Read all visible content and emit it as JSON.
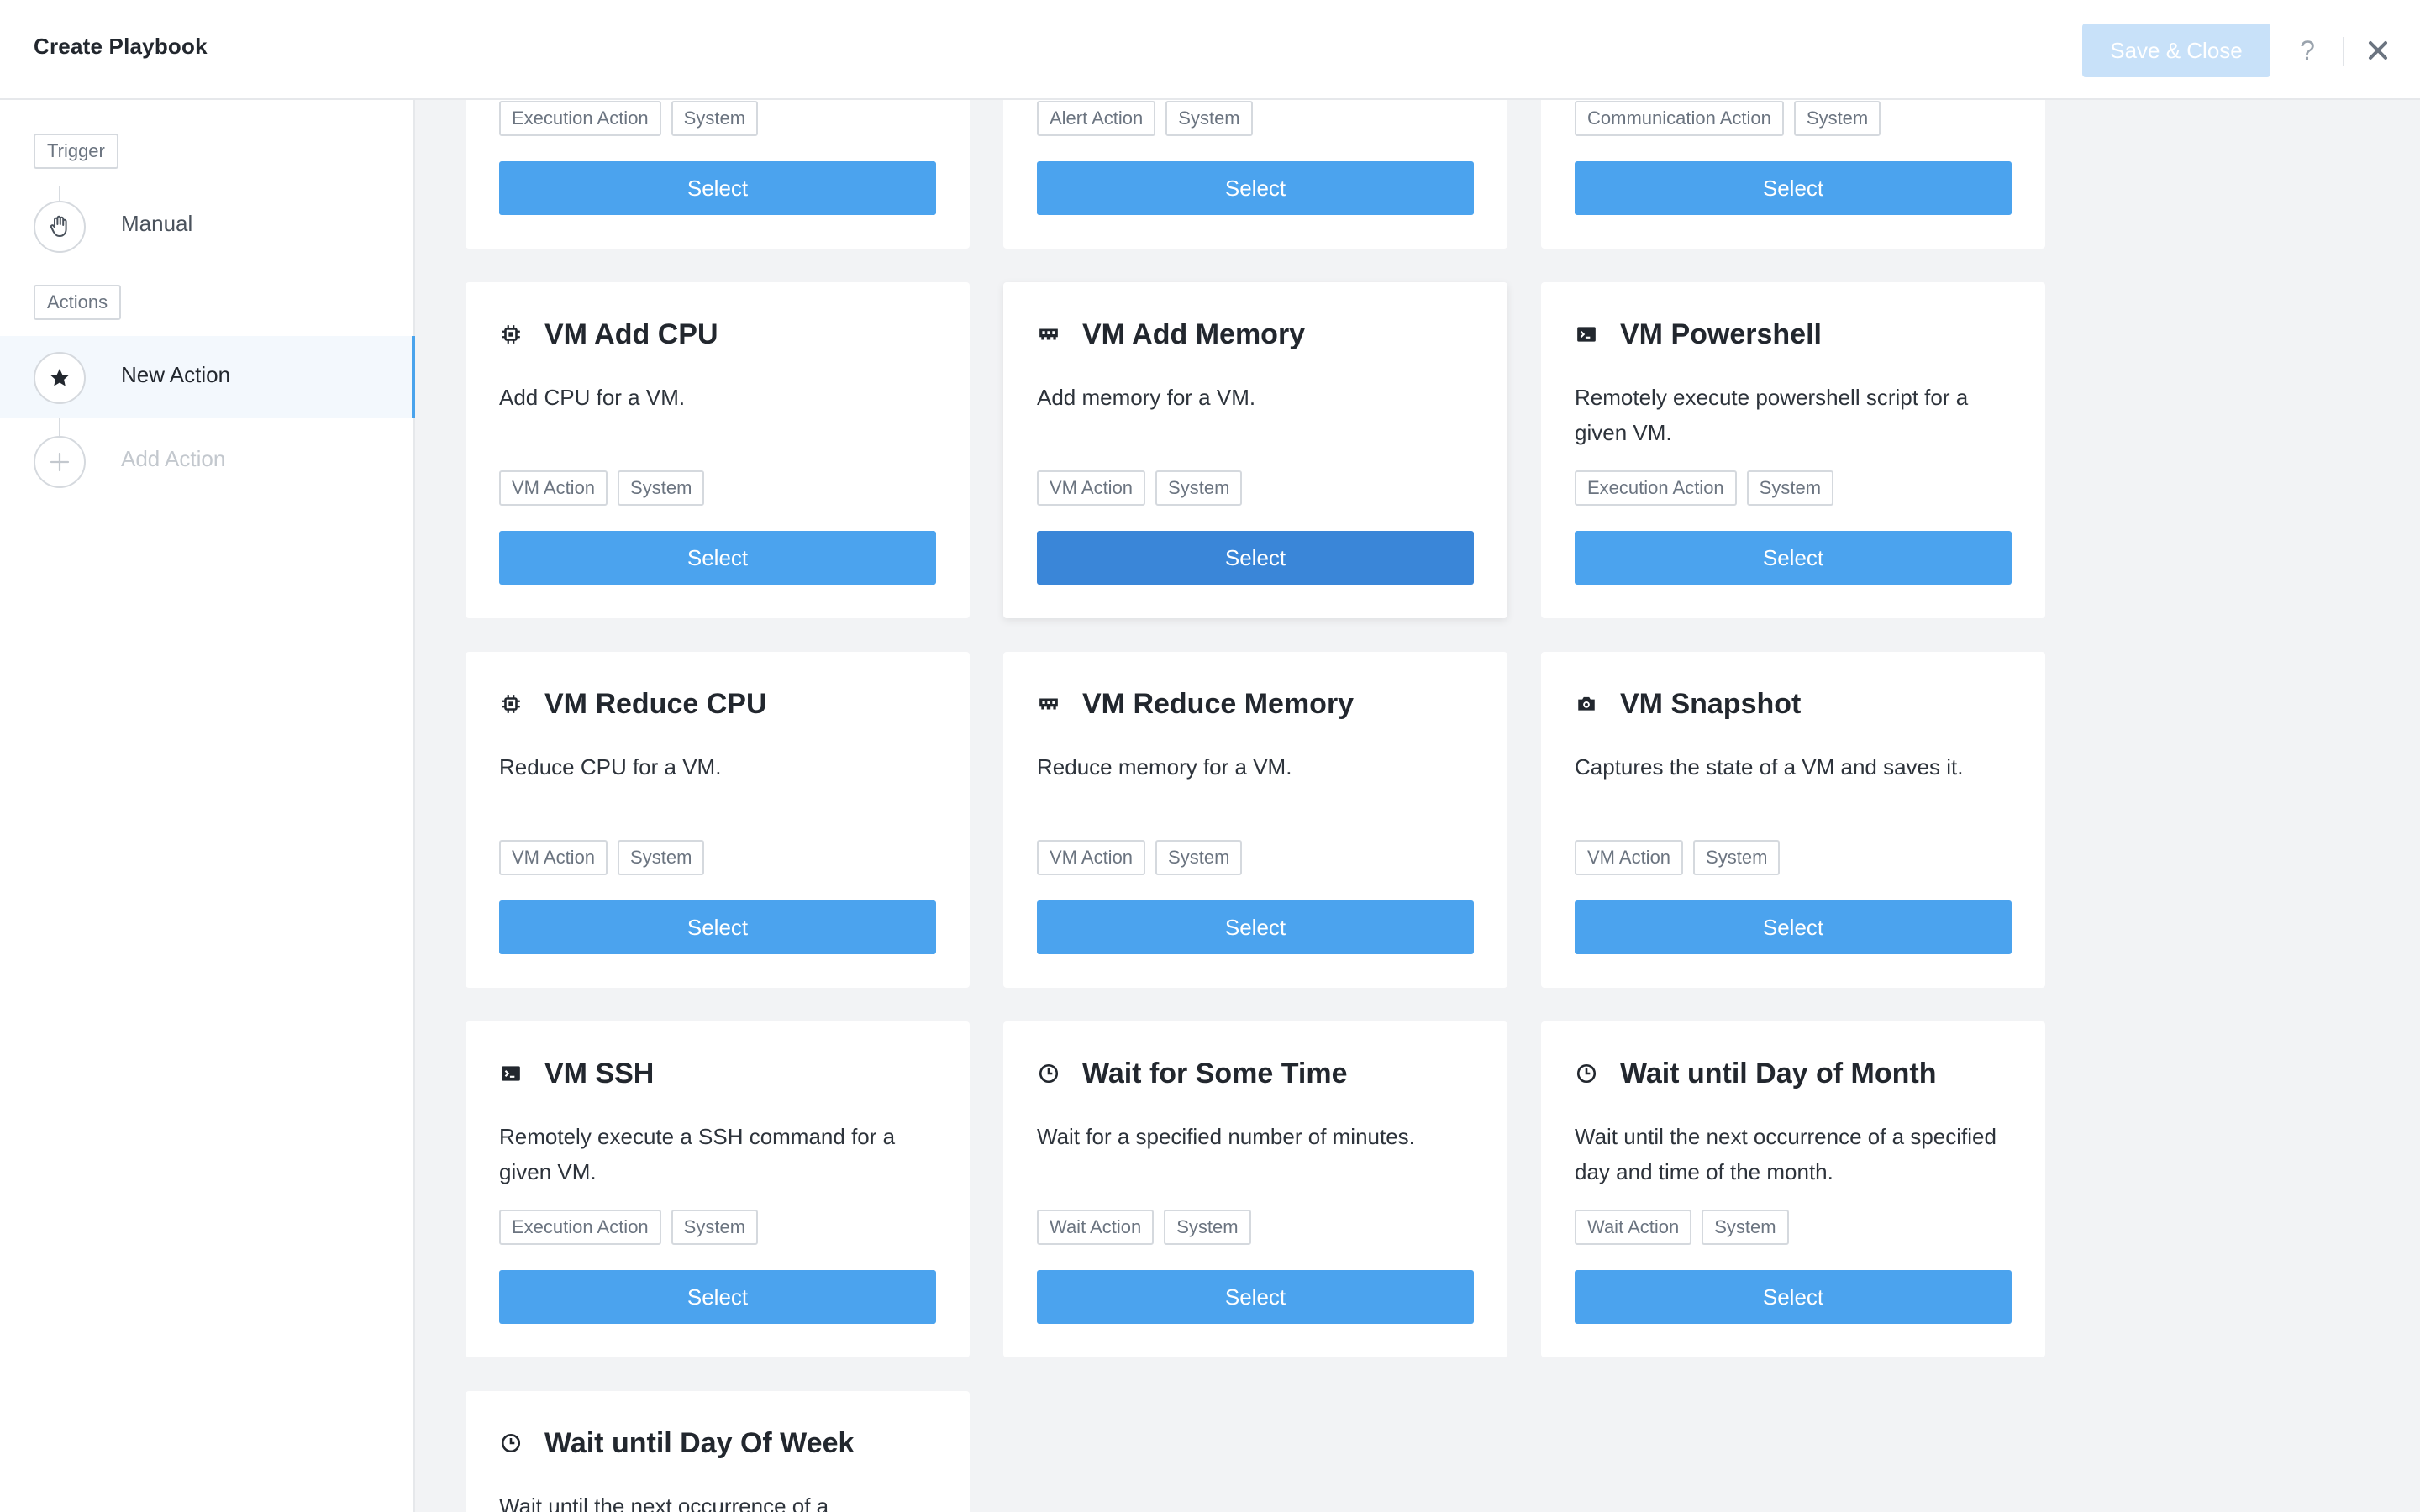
{
  "header": {
    "title": "Create Playbook",
    "save_label": "Save & Close",
    "help_label": "?"
  },
  "sidebar": {
    "trigger_tag": "Trigger",
    "trigger_step": "Manual",
    "actions_tag": "Actions",
    "action_step": "New Action",
    "add_step": "Add Action"
  },
  "cards": [
    {
      "title": "",
      "desc": "",
      "tags": [
        "Execution Action",
        "System"
      ],
      "button": "Select"
    },
    {
      "title": "",
      "desc": "",
      "tags": [
        "Alert Action",
        "System"
      ],
      "button": "Select"
    },
    {
      "title": "",
      "desc": "",
      "tags": [
        "Communication Action",
        "System"
      ],
      "button": "Select"
    },
    {
      "title": "VM Add CPU",
      "icon": "cpu-icon",
      "desc": "Add CPU for a VM.",
      "tags": [
        "VM Action",
        "System"
      ],
      "button": "Select"
    },
    {
      "title": "VM Add Memory",
      "icon": "memory-icon",
      "desc": "Add memory for a VM.",
      "tags": [
        "VM Action",
        "System"
      ],
      "button": "Select"
    },
    {
      "title": "VM Powershell",
      "icon": "terminal-icon",
      "desc": "Remotely execute powershell script for a given VM.",
      "tags": [
        "Execution Action",
        "System"
      ],
      "button": "Select"
    },
    {
      "title": "VM Reduce CPU",
      "icon": "cpu-icon",
      "desc": "Reduce CPU for a VM.",
      "tags": [
        "VM Action",
        "System"
      ],
      "button": "Select"
    },
    {
      "title": "VM Reduce Memory",
      "icon": "memory-icon",
      "desc": "Reduce memory for a VM.",
      "tags": [
        "VM Action",
        "System"
      ],
      "button": "Select"
    },
    {
      "title": "VM Snapshot",
      "icon": "camera-icon",
      "desc": "Captures the state of a VM and saves it.",
      "tags": [
        "VM Action",
        "System"
      ],
      "button": "Select"
    },
    {
      "title": "VM SSH",
      "icon": "terminal-icon",
      "desc": "Remotely execute a SSH command for a given VM.",
      "tags": [
        "Execution Action",
        "System"
      ],
      "button": "Select"
    },
    {
      "title": "Wait for Some Time",
      "icon": "clock-icon",
      "desc": "Wait for a specified number of minutes.",
      "tags": [
        "Wait Action",
        "System"
      ],
      "button": "Select"
    },
    {
      "title": "Wait until Day of Month",
      "icon": "clock-icon",
      "desc": "Wait until the next occurrence of a specified day and time of the month.",
      "tags": [
        "Wait Action",
        "System"
      ],
      "button": "Select"
    },
    {
      "title": "Wait until Day Of Week",
      "icon": "clock-icon",
      "desc": "Wait until the next occurrence of a",
      "tags": [],
      "button": ""
    }
  ],
  "colors": {
    "accent": "#4ba3ee",
    "accent_pressed": "#3a86d8",
    "save_disabled": "#c8e1f9",
    "background": "#f2f3f5"
  }
}
